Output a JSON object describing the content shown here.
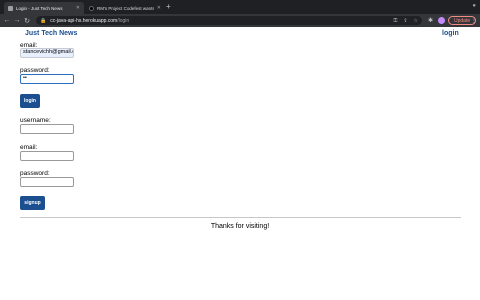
{
  "browser": {
    "tabs": [
      {
        "title": "Login - Just Tech News",
        "active": true
      },
      {
        "title": "RM's Project Codefest wants ...",
        "active": false
      }
    ],
    "address_host": "cc-java-api-hs.herokuapp.com",
    "address_path": "/login",
    "update_label": "Update"
  },
  "site": {
    "brand": "Just Tech News",
    "nav_login": "login"
  },
  "login_form": {
    "email_label": "email:",
    "email_value": "stancevichh@gmail.com",
    "password_label": "password:",
    "password_value": "••",
    "submit_label": "login"
  },
  "signup_form": {
    "username_label": "username:",
    "email_label": "email:",
    "password_label": "password:",
    "submit_label": "signup"
  },
  "footer": {
    "text": "Thanks for visiting!"
  },
  "colors": {
    "brand": "#1b4f8f",
    "button_bg": "#1b4f8f",
    "autofill_bg": "#e8f0fe",
    "chrome_dark": "#1f2023"
  }
}
